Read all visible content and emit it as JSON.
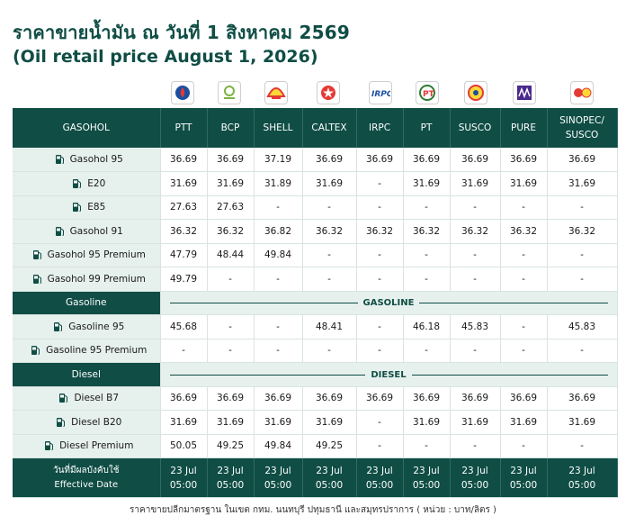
{
  "title_th": "ราคาขายน้ำมัน ณ วันที่ 1 สิงหาคม 2569",
  "title_en": "(Oil retail price August 1, 2026)",
  "colors": {
    "primary": "#0f4d45",
    "row_bg": "#e6f0ed"
  },
  "header": {
    "first_col": "GASOHOL",
    "brands": [
      {
        "name": "PTT",
        "icon": "ptt-logo"
      },
      {
        "name": "BCP",
        "icon": "bcp-logo"
      },
      {
        "name": "SHELL",
        "icon": "shell-logo"
      },
      {
        "name": "CALTEX",
        "icon": "caltex-logo"
      },
      {
        "name": "IRPC",
        "icon": "irpc-logo"
      },
      {
        "name": "PT",
        "icon": "pt-logo"
      },
      {
        "name": "SUSCO",
        "icon": "susco-logo"
      },
      {
        "name": "PURE",
        "icon": "pure-logo"
      },
      {
        "name": "SINOPEC/\nSUSCO",
        "icon": "sinopec-logo",
        "line1": "SINOPEC/",
        "line2": "SUSCO"
      }
    ]
  },
  "gasohol_rows": [
    {
      "name": "Gasohol 95",
      "values": [
        "36.69",
        "36.69",
        "37.19",
        "36.69",
        "36.69",
        "36.69",
        "36.69",
        "36.69",
        "36.69"
      ]
    },
    {
      "name": "E20",
      "values": [
        "31.69",
        "31.69",
        "31.89",
        "31.69",
        "-",
        "31.69",
        "31.69",
        "31.69",
        "31.69"
      ]
    },
    {
      "name": "E85",
      "values": [
        "27.63",
        "27.63",
        "-",
        "-",
        "-",
        "-",
        "-",
        "-",
        "-"
      ]
    },
    {
      "name": "Gasohol 91",
      "values": [
        "36.32",
        "36.32",
        "36.82",
        "36.32",
        "36.32",
        "36.32",
        "36.32",
        "36.32",
        "36.32"
      ]
    },
    {
      "name": "Gasohol 95 Premium",
      "values": [
        "47.79",
        "48.44",
        "49.84",
        "-",
        "-",
        "-",
        "-",
        "-",
        "-"
      ]
    },
    {
      "name": "Gasohol 99 Premium",
      "values": [
        "49.79",
        "-",
        "-",
        "-",
        "-",
        "-",
        "-",
        "-",
        "-"
      ]
    }
  ],
  "gasoline_section": {
    "left": "Gasoline",
    "right": "GASOLINE"
  },
  "gasoline_rows": [
    {
      "name": "Gasoline 95",
      "values": [
        "45.68",
        "-",
        "-",
        "48.41",
        "-",
        "46.18",
        "45.83",
        "-",
        "45.83"
      ]
    },
    {
      "name": "Gasoline 95 Premium",
      "values": [
        "-",
        "-",
        "-",
        "-",
        "-",
        "-",
        "-",
        "-",
        "-"
      ]
    }
  ],
  "diesel_section": {
    "left": "Diesel",
    "right": "DIESEL"
  },
  "diesel_rows": [
    {
      "name": "Diesel B7",
      "values": [
        "36.69",
        "36.69",
        "36.69",
        "36.69",
        "36.69",
        "36.69",
        "36.69",
        "36.69",
        "36.69"
      ]
    },
    {
      "name": "Diesel B20",
      "values": [
        "31.69",
        "31.69",
        "31.69",
        "31.69",
        "-",
        "31.69",
        "31.69",
        "31.69",
        "31.69"
      ]
    },
    {
      "name": "Diesel Premium",
      "values": [
        "50.05",
        "49.25",
        "49.84",
        "49.25",
        "-",
        "-",
        "-",
        "-",
        "-"
      ]
    }
  ],
  "effective": {
    "label_th": "วันที่มีผลบังคับใช้",
    "label_en": "Effective Date",
    "date": "23 Jul",
    "time": "05:00"
  },
  "footnote": "ราคาขายปลีกมาตรฐาน ในเขต กทม. นนทบุรี ปทุมธานี และสมุทรปราการ ( หน่วย : บาท/ลิตร )"
}
